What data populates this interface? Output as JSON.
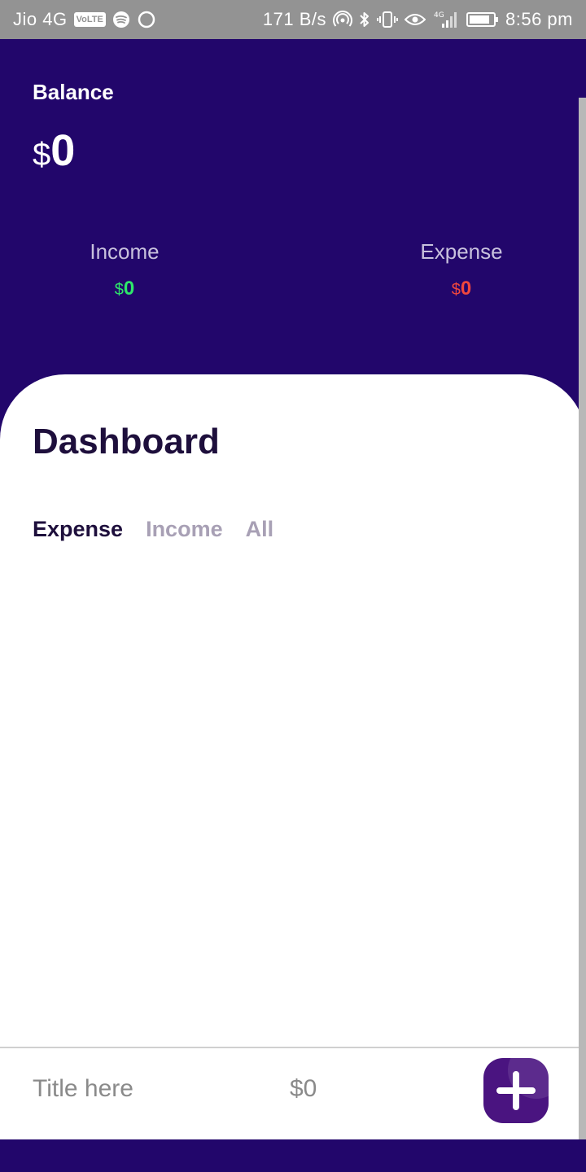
{
  "status_bar": {
    "carrier": "Jio 4G",
    "volte": "VoLTE",
    "net_speed": "171 B/s",
    "network_type": "4G",
    "time": "8:56 pm",
    "icons": [
      "spotify-icon",
      "loading-circle-icon",
      "hotspot-icon",
      "bluetooth-icon",
      "vibrate-icon",
      "eye-icon",
      "signal-icon",
      "battery-icon"
    ]
  },
  "header": {
    "balance_label": "Balance",
    "balance_currency": "$",
    "balance_value": "0",
    "income_label": "Income",
    "income_currency": "$",
    "income_value": "0",
    "expense_label": "Expense",
    "expense_currency": "$",
    "expense_value": "0"
  },
  "dashboard": {
    "title": "Dashboard",
    "tabs": [
      {
        "label": "Expense",
        "active": true
      },
      {
        "label": "Income",
        "active": false
      },
      {
        "label": "All",
        "active": false
      }
    ]
  },
  "entry": {
    "title_placeholder": "Title here",
    "amount_placeholder": "$0",
    "add_icon": "plus-icon"
  },
  "colors": {
    "header_bg": "#22066b",
    "income": "#2ee86a",
    "expense": "#f0473d",
    "add_button": "#4a1480",
    "title_text": "#1e0f3c"
  }
}
